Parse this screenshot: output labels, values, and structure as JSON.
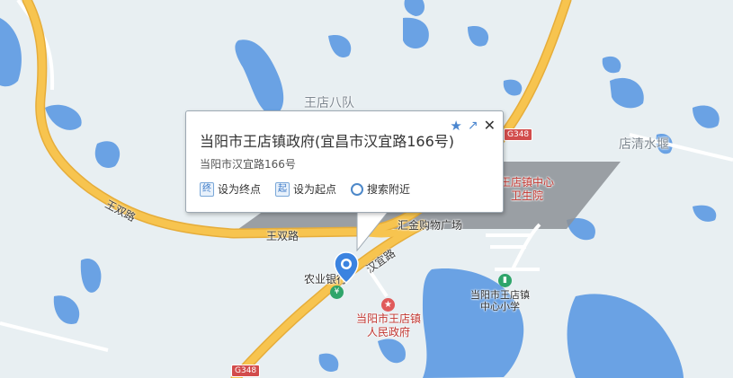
{
  "popup": {
    "title": "当阳市王店镇政府(宜昌市汉宜路166号)",
    "address": "当阳市汉宜路166号",
    "actions": [
      {
        "icon_text": "终",
        "label": "设为终点"
      },
      {
        "icon_text": "起",
        "label": "设为起点"
      },
      {
        "icon_text": "",
        "label": "搜索附近"
      }
    ],
    "icons": [
      "star-icon",
      "share-icon",
      "close-icon"
    ]
  },
  "labels": {
    "area_wangdian_8": "王店八队",
    "area_dianqing": "店清水堰",
    "road_wangshuang_1": "王双路",
    "road_wangshuang_2": "王双路",
    "road_hanyi": "汉宜路",
    "g348_top": "G348",
    "g348_bottom": "G348",
    "hospital_line1": "王店镇中心",
    "hospital_line2": "卫生院",
    "mall": "汇金购物广场",
    "bank": "农业银行",
    "gov_line1": "当阳市王店镇",
    "gov_line2": "人民政府",
    "school_line1": "当阳市王店镇",
    "school_line2": "中心小学"
  },
  "colors": {
    "land": "#e8eff2",
    "water": "#6aa2e4",
    "road": "#f7c44f",
    "road_edge": "#e6ad3a",
    "minor_road": "#ffffff",
    "building_shadow": "#8c9096",
    "pin": "#3b83e0",
    "gov_red": "#e05a5a",
    "green": "#2fa56a"
  }
}
